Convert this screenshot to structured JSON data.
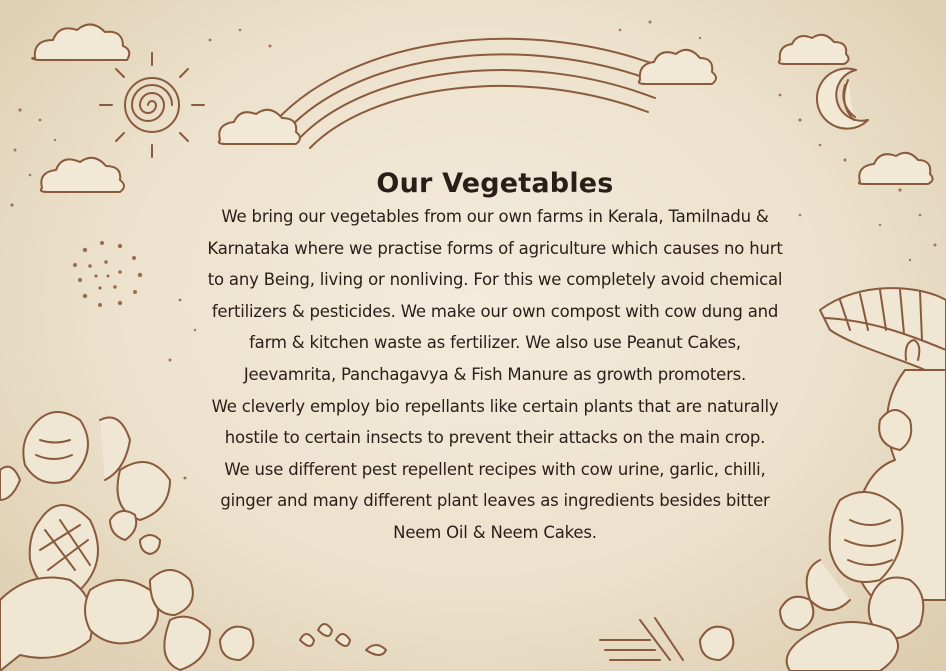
{
  "title": "Our Vegetables",
  "lines": [
    "We bring our vegetables from our own farms in Kerala, Tamilnadu &",
    "Karnataka where we practise forms of agriculture which causes no hurt",
    "to any Being, living or nonliving. For this we completely avoid chemical",
    "fertilizers & pesticides. We make our own compost with cow dung and",
    "farm & kitchen waste as fertilizer. We also use Peanut Cakes,",
    "Jeevamrita, Panchagavya & Fish Manure as growth promoters.",
    "We cleverly employ bio repellants like certain plants that are naturally",
    "hostile to certain insects to prevent their attacks on the main crop.",
    "We use different pest repellent recipes with cow urine, garlic, chilli,",
    "ginger and many different plant leaves as ingredients besides bitter",
    "Neem Oil & Neem Cakes."
  ],
  "colors": {
    "paper": "#ece1cc",
    "ink": "#2a1e18",
    "sketch": "#8a5a3c"
  },
  "decorations": [
    "sun-icon",
    "rainbow-icon",
    "cloud-icon",
    "moon-icon",
    "vegetables-illustration",
    "banana-leaf-icon"
  ]
}
